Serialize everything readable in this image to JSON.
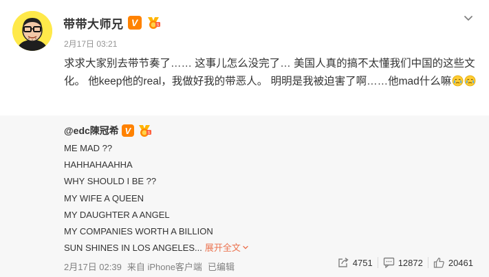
{
  "post": {
    "author": "带带大师兄",
    "time": "2月17日 03:21",
    "text": "求求大家别去带节奏了…… 这事儿怎么没完了… 美国人真的搞不太懂我们中国的这些文化。 他keep他的real，我做好我的带恶人。 明明是我被迫害了啊……他mad什么嘛",
    "emojis": [
      "crying-emoji",
      "crying-emoji"
    ]
  },
  "repost": {
    "user": "@edc陳冠希",
    "lines": [
      "ME MAD ??",
      "HAHHAHAAHHA",
      "WHY SHOULD I BE ??",
      "MY WIFE A QUEEN",
      "MY DAUGHTER A ANGEL",
      "MY COMPANIES WORTH A BILLION",
      "SUN SHINES IN LOS ANGELES..."
    ],
    "expand_label": "展开全文",
    "time": "2月17日 02:39",
    "source": "来自 iPhone客户端",
    "edited": "已编辑"
  },
  "actions": {
    "repost_count": "4751",
    "comment_count": "12872",
    "like_count": "20461"
  },
  "badges": {
    "verified": "V"
  },
  "colors": {
    "accent": "#ff8200",
    "link": "#eb7350",
    "repost_bg": "#f7f7f7"
  }
}
